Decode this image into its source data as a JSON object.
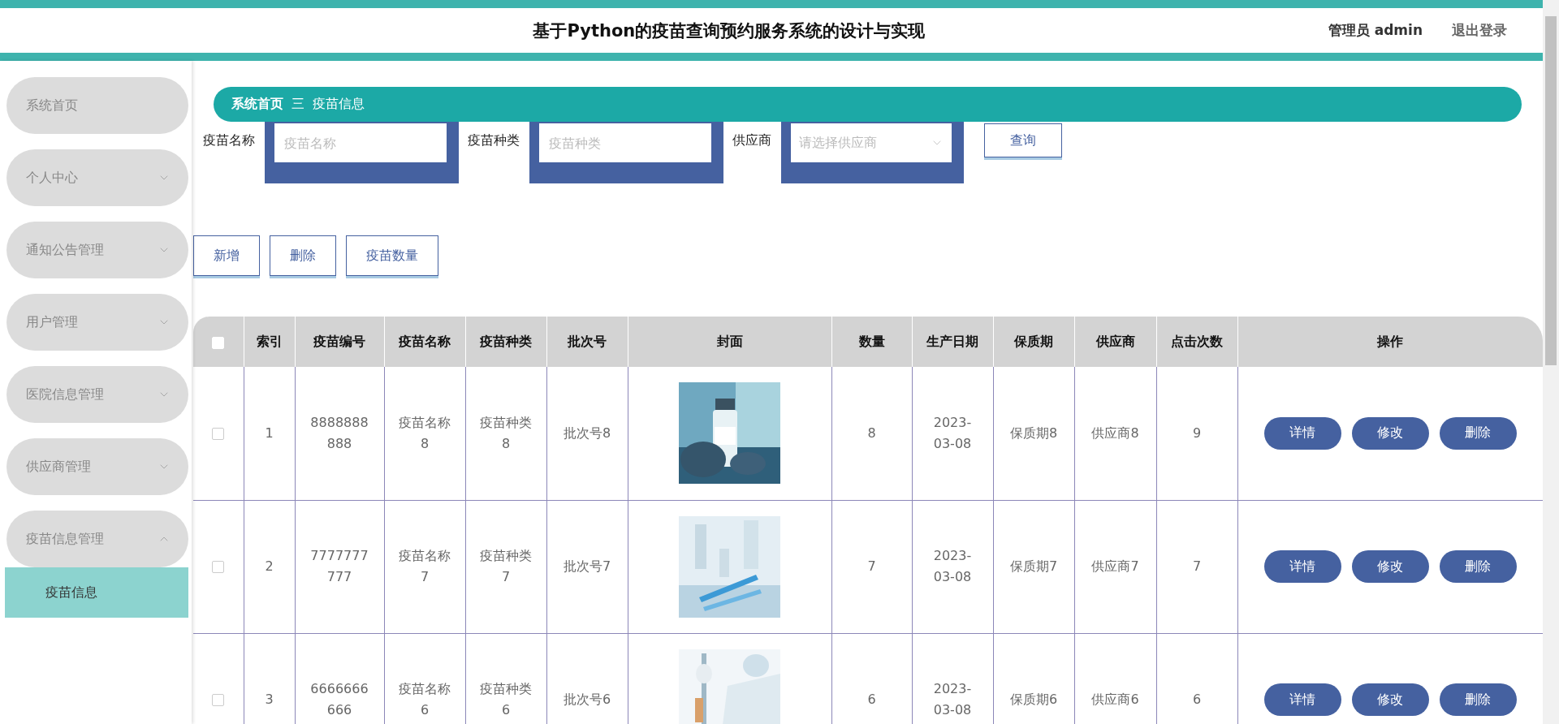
{
  "header": {
    "title": "基于Python的疫苗查询预约服务系统的设计与实现",
    "user": "管理员 admin",
    "logout": "退出登录"
  },
  "sidebar": {
    "items": [
      {
        "label": "系统首页",
        "kind": "link"
      },
      {
        "label": "个人中心",
        "kind": "menu",
        "expanded": false
      },
      {
        "label": "通知公告管理",
        "kind": "menu",
        "expanded": false
      },
      {
        "label": "用户管理",
        "kind": "menu",
        "expanded": false
      },
      {
        "label": "医院信息管理",
        "kind": "menu",
        "expanded": false
      },
      {
        "label": "供应商管理",
        "kind": "menu",
        "expanded": false
      },
      {
        "label": "疫苗信息管理",
        "kind": "menu",
        "expanded": true,
        "children": [
          {
            "label": "疫苗信息",
            "selected": true
          }
        ]
      }
    ]
  },
  "breadcrumb": {
    "home": "系统首页",
    "separator": "三",
    "current": "疫苗信息"
  },
  "search": {
    "fields": [
      {
        "label": "疫苗名称",
        "placeholder": "疫苗名称",
        "kind": "input"
      },
      {
        "label": "疫苗种类",
        "placeholder": "疫苗种类",
        "kind": "input"
      },
      {
        "label": "供应商",
        "placeholder": "请选择供应商",
        "kind": "select"
      }
    ],
    "button": "查询"
  },
  "actions": [
    "新增",
    "删除",
    "疫苗数量"
  ],
  "table": {
    "select_all_checked": false,
    "columns": [
      "索引",
      "疫苗编号",
      "疫苗名称",
      "疫苗种类",
      "批次号",
      "封面",
      "数量",
      "生产日期",
      "保质期",
      "供应商",
      "点击次数",
      "操作"
    ],
    "rows": [
      {
        "checked": false,
        "cells": [
          "1",
          "8888888888",
          "疫苗名称8",
          "疫苗种类8",
          "批次号8"
        ],
        "rest": [
          "8",
          "2023-03-08",
          "保质期8",
          "供应商8",
          "9"
        ],
        "actions": [
          "详情",
          "修改",
          "删除"
        ]
      },
      {
        "checked": false,
        "cells": [
          "2",
          "7777777777",
          "疫苗名称7",
          "疫苗种类7",
          "批次号7"
        ],
        "rest": [
          "7",
          "2023-03-08",
          "保质期7",
          "供应商7",
          "7"
        ],
        "actions": [
          "详情",
          "修改",
          "删除"
        ]
      },
      {
        "checked": false,
        "cells": [
          "3",
          "6666666666",
          "疫苗名称6",
          "疫苗种类6",
          "批次号6"
        ],
        "rest": [
          "6",
          "2023-03-08",
          "保质期6",
          "供应商6",
          "6"
        ],
        "actions": [
          "详情",
          "修改",
          "删除"
        ]
      }
    ]
  }
}
